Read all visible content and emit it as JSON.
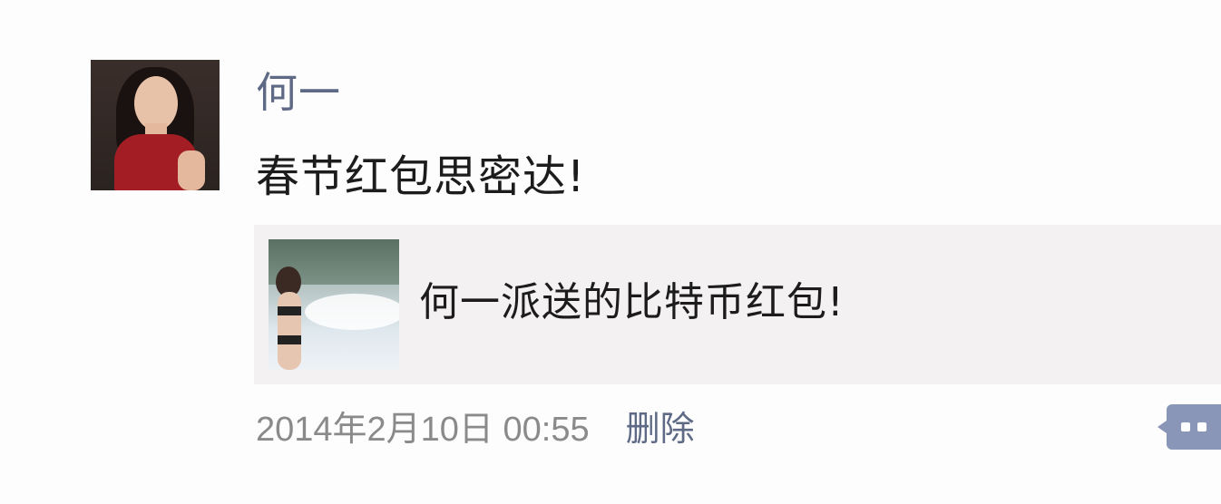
{
  "post": {
    "author_name": "何一",
    "text": "春节红包思密达!",
    "shared_link": {
      "title": "何一派送的比特币红包!"
    },
    "timestamp": "2014年2月10日 00:55",
    "delete_label": "删除",
    "more_icon": "comment-dots-icon"
  },
  "colors": {
    "author_name": "#5e6a85",
    "body_text": "#1c1c1c",
    "timestamp": "#8a8a8a",
    "card_background": "#f3f1f2",
    "more_button": "#8a96b8"
  }
}
